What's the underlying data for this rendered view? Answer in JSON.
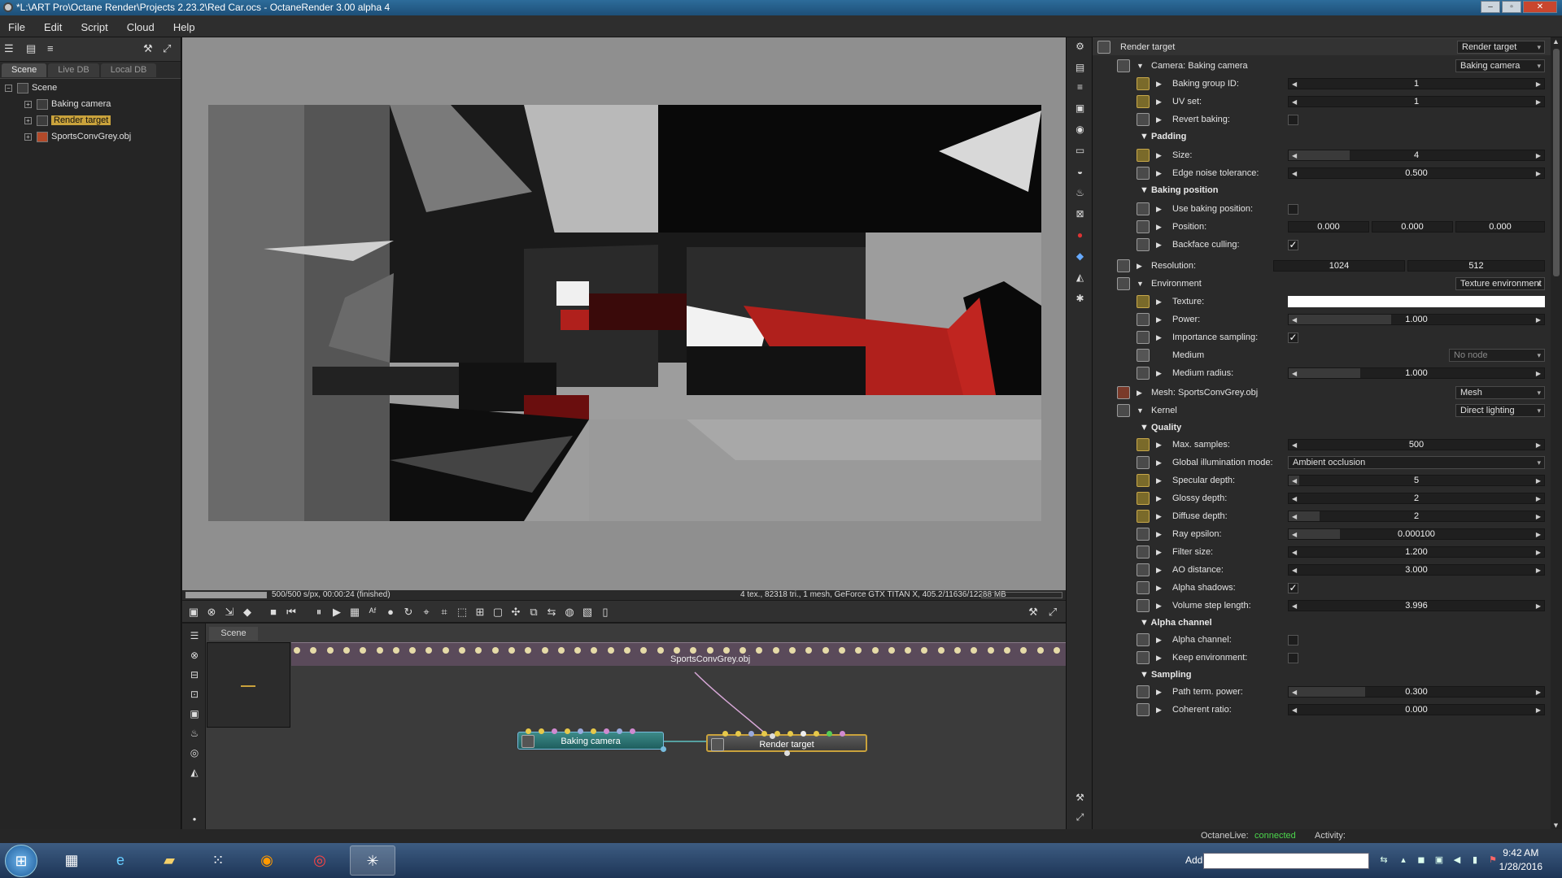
{
  "window": {
    "title": "*L:\\ART Pro\\Octane Render\\Projects 2.23.2\\Red Car.ocs - OctaneRender 3.00 alpha 4"
  },
  "menu": [
    "File",
    "Edit",
    "Script",
    "Cloud",
    "Help"
  ],
  "left_tabs": [
    "Scene",
    "Live DB",
    "Local DB"
  ],
  "tree": {
    "root": "Scene",
    "items": [
      "Baking camera",
      "Render target",
      "SportsConvGrey.obj"
    ]
  },
  "render_status": {
    "left": "500/500 s/px, 00:00:24 (finished)",
    "right": "4 tex., 82318 tri., 1 mesh, GeForce GTX TITAN X, 405.2/11636/12288 MB",
    "progress": 1.0
  },
  "graph": {
    "tab": "Scene",
    "mesh_label": "SportsConvGrey.obj",
    "node_camera": "Baking camera",
    "node_target": "Render target"
  },
  "props": {
    "render_target": {
      "label": "Render target",
      "dropdown": "Render target"
    },
    "camera": {
      "label": "Camera: Baking camera",
      "dropdown": "Baking camera"
    },
    "baking_group_id": {
      "label": "Baking group ID:",
      "value": "1"
    },
    "uv_set": {
      "label": "UV set:",
      "value": "1"
    },
    "revert_baking": {
      "label": "Revert baking:"
    },
    "padding": {
      "title": "Padding"
    },
    "size": {
      "label": "Size:",
      "value": "4"
    },
    "edge_noise": {
      "label": "Edge noise tolerance:",
      "value": "0.500"
    },
    "baking_position": {
      "title": "Baking position"
    },
    "use_baking_position": {
      "label": "Use baking position:"
    },
    "position": {
      "label": "Position:",
      "x": "0.000",
      "y": "0.000",
      "z": "0.000"
    },
    "backface_culling": {
      "label": "Backface culling:"
    },
    "resolution": {
      "label": "Resolution:",
      "w": "1024",
      "h": "512"
    },
    "environment": {
      "label": "Environment",
      "dropdown": "Texture environment"
    },
    "texture": {
      "label": "Texture:"
    },
    "power": {
      "label": "Power:",
      "value": "1.000"
    },
    "importance_sampling": {
      "label": "Importance sampling:"
    },
    "medium": {
      "label": "Medium",
      "dropdown": "No node"
    },
    "medium_radius": {
      "label": "Medium radius:",
      "value": "1.000"
    },
    "mesh": {
      "label": "Mesh: SportsConvGrey.obj",
      "dropdown": "Mesh"
    },
    "kernel": {
      "label": "Kernel",
      "dropdown": "Direct lighting"
    },
    "quality": {
      "title": "Quality"
    },
    "max_samples": {
      "label": "Max. samples:",
      "value": "500"
    },
    "gi_mode": {
      "label": "Global illumination mode:",
      "value": "Ambient occlusion"
    },
    "specular_depth": {
      "label": "Specular depth:",
      "value": "5"
    },
    "glossy_depth": {
      "label": "Glossy depth:",
      "value": "2"
    },
    "diffuse_depth": {
      "label": "Diffuse depth:",
      "value": "2"
    },
    "ray_epsilon": {
      "label": "Ray epsilon:",
      "value": "0.000100"
    },
    "filter_size": {
      "label": "Filter size:",
      "value": "1.200"
    },
    "ao_distance": {
      "label": "AO distance:",
      "value": "3.000"
    },
    "alpha_shadows": {
      "label": "Alpha shadows:"
    },
    "volume_step": {
      "label": "Volume step length:",
      "value": "3.996"
    },
    "alpha_channel_sec": {
      "title": "Alpha channel"
    },
    "alpha_channel": {
      "label": "Alpha channel:"
    },
    "keep_environment": {
      "label": "Keep environment:"
    },
    "sampling": {
      "title": "Sampling"
    },
    "path_term": {
      "label": "Path term. power:",
      "value": "0.300"
    },
    "coherent_ratio": {
      "label": "Coherent ratio:",
      "value": "0.000"
    }
  },
  "statusbar": {
    "octanelive": "OctaneLive:",
    "connected": "connected",
    "activity": "Activity:"
  },
  "taskbar": {
    "address": "Address",
    "time": "9:42 AM",
    "date": "1/28/2016"
  },
  "colors": {
    "accent": "#c9a23c",
    "connected": "#4cd64c",
    "red": "#b0201c"
  }
}
